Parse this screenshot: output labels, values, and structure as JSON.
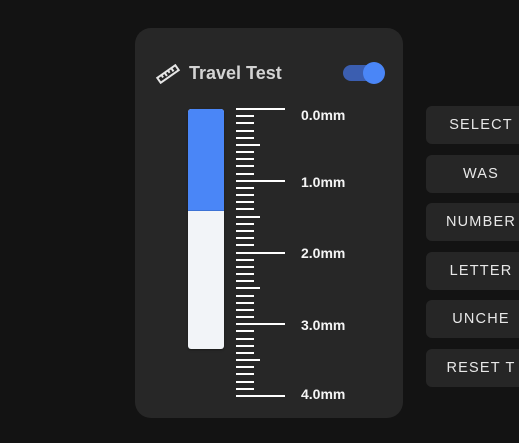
{
  "card": {
    "title": "Travel Test",
    "header_icon": "ruler-icon",
    "toggle_on": true,
    "travel_fraction": 0.42,
    "scale": {
      "min_mm": 0,
      "max_mm": 4,
      "labels": [
        "0.0mm",
        "1.0mm",
        "2.0mm",
        "3.0mm",
        "4.0mm"
      ]
    }
  },
  "side_buttons": [
    "SELECT",
    "WAS",
    "NUMBER",
    "LETTER",
    "UNCHE",
    "RESET T"
  ],
  "colors": {
    "accent": "#4a86f7",
    "card_bg": "#272727",
    "page_bg": "#131313",
    "bar_empty": "#f2f4f8"
  }
}
